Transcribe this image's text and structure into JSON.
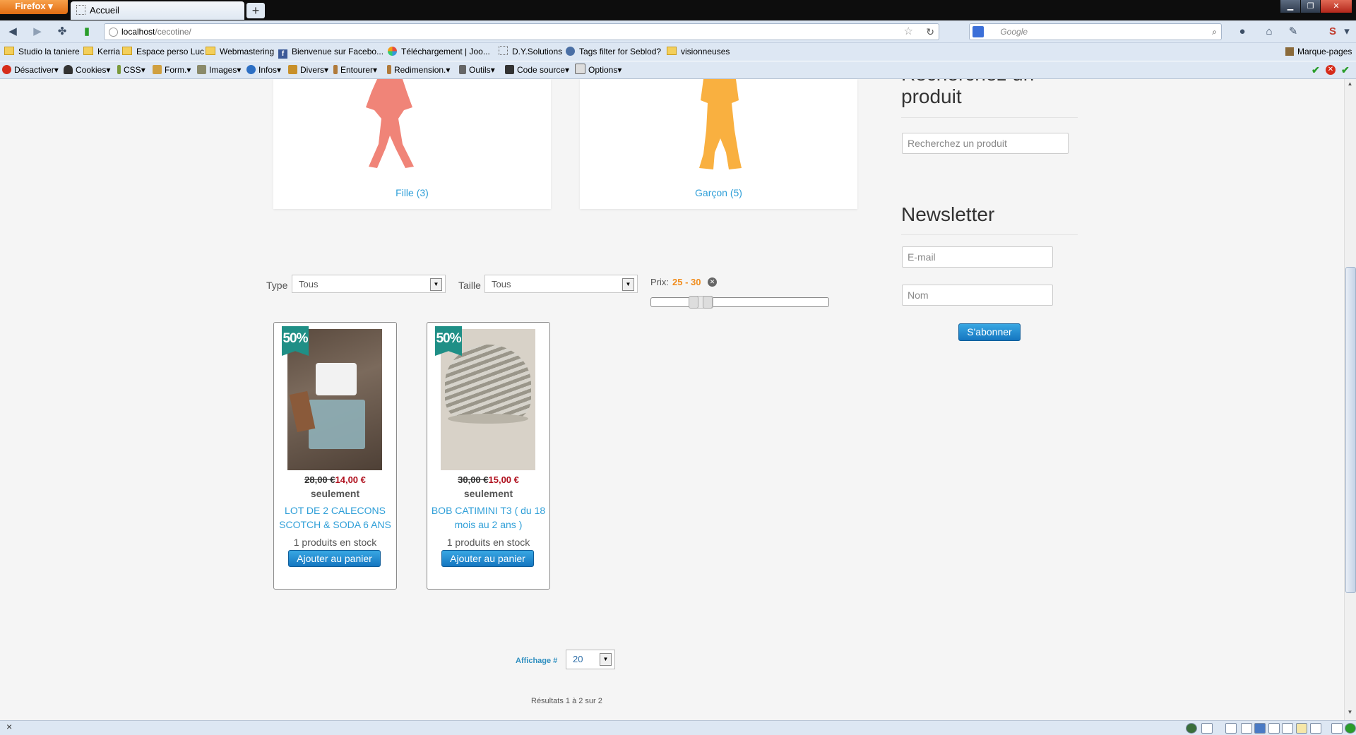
{
  "browser": {
    "app_button": "Firefox",
    "tab_title": "Accueil",
    "new_tab": "+",
    "url_host": "localhost",
    "url_path": "/cecotine/",
    "search_placeholder": "Google",
    "bookmarks": [
      "Studio la taniere",
      "Kerria",
      "Espace perso Luc",
      "Webmastering",
      "Bienvenue sur Facebo...",
      "Téléchargement | Joo...",
      "D.Y.Solutions",
      "Tags filter for Seblod?",
      "visionneuses"
    ],
    "bookmarks_right": "Marque-pages",
    "devtools": [
      "Désactiver",
      "Cookies",
      "CSS",
      "Form.",
      "Images",
      "Infos",
      "Divers",
      "Entourer",
      "Redimension.",
      "Outils",
      "Code source",
      "Options"
    ],
    "status_close": "×"
  },
  "categories": [
    {
      "label": "Fille (3)",
      "color": "#f08478"
    },
    {
      "label": "Garçon (5)",
      "color": "#f9b040"
    }
  ],
  "filters": {
    "type_label": "Type",
    "type_value": "Tous",
    "size_label": "Taille",
    "size_value": "Tous",
    "price_label": "Prix:",
    "price_range": "25 - 30"
  },
  "products": [
    {
      "badge": "50%",
      "old_price": "28,00 €",
      "new_price": "14,00 €",
      "only": "seulement",
      "title": "LOT DE 2 CALECONS SCOTCH & SODA 6 ANS",
      "stock": "1 produits en stock",
      "button": "Ajouter au panier"
    },
    {
      "badge": "50%",
      "old_price": "30,00 €",
      "new_price": "15,00 €",
      "only": "seulement",
      "title": "BOB CATIMINI T3 ( du 18 mois au 2 ans )",
      "stock": "1 produits en stock",
      "button": "Ajouter au panier"
    }
  ],
  "pagination": {
    "display_label": "Affichage #",
    "display_value": "20",
    "results": "Résultats 1 à 2 sur 2"
  },
  "sidebar": {
    "search_heading": "Recherchez un produit",
    "search_placeholder": "Recherchez un produit",
    "newsletter_heading": "Newsletter",
    "email_placeholder": "E-mail",
    "name_placeholder": "Nom",
    "subscribe_button": "S'abonner"
  },
  "colors": {
    "accent_blue": "#2f9fd8",
    "price_red": "#b0101e",
    "price_range_orange": "#f08c1c",
    "badge_teal": "#1f8f86"
  }
}
